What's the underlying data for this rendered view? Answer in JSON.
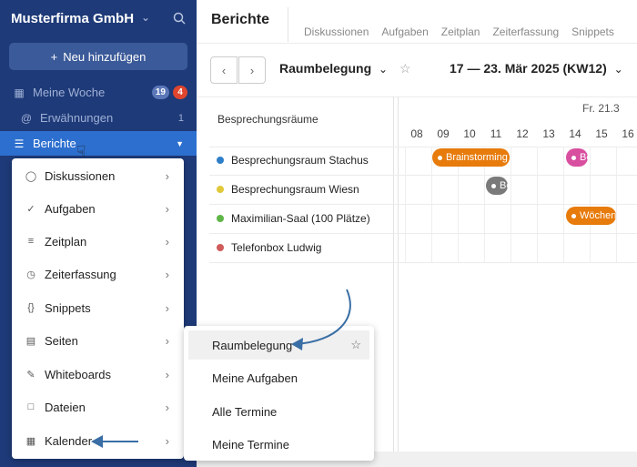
{
  "sidebar": {
    "org_name": "Musterfirma GmbH",
    "new_button": "Neu hinzufügen",
    "items": [
      {
        "label": "Meine Woche",
        "badge1": "19",
        "badge2": "4"
      },
      {
        "label": "Erwähnungen",
        "count": "1"
      },
      {
        "label": "Berichte"
      }
    ]
  },
  "berichte_menu": [
    {
      "label": "Diskussionen",
      "icon": "chat-icon"
    },
    {
      "label": "Aufgaben",
      "icon": "check-circle-icon"
    },
    {
      "label": "Zeitplan",
      "icon": "timeline-icon"
    },
    {
      "label": "Zeiterfassung",
      "icon": "clock-icon"
    },
    {
      "label": "Snippets",
      "icon": "braces-icon"
    },
    {
      "label": "Seiten",
      "icon": "page-icon"
    },
    {
      "label": "Whiteboards",
      "icon": "pen-icon"
    },
    {
      "label": "Dateien",
      "icon": "file-icon"
    },
    {
      "label": "Kalender",
      "icon": "calendar-icon"
    }
  ],
  "kalender_submenu": [
    {
      "label": "Raumbelegung"
    },
    {
      "label": "Meine Aufgaben"
    },
    {
      "label": "Alle Termine"
    },
    {
      "label": "Meine Termine"
    }
  ],
  "main": {
    "title": "Berichte",
    "tabs": [
      "Diskussionen",
      "Aufgaben",
      "Zeitplan",
      "Zeiterfassung",
      "Snippets"
    ],
    "view_name": "Raumbelegung",
    "date_range": "17 — 23. Mär 2025 (KW12)",
    "rooms_header": "Besprechungsräume",
    "day_label": "Fr. 21.3",
    "hours": [
      "08",
      "09",
      "10",
      "11",
      "12",
      "13",
      "14",
      "15",
      "16"
    ],
    "rooms": [
      {
        "name": "Besprechungsraum Stachus",
        "color": "#2f7fc8"
      },
      {
        "name": "Besprechungsraum Wiesn",
        "color": "#e0c93a"
      },
      {
        "name": "Maximilian-Saal (100 Plätze)",
        "color": "#5fb548"
      },
      {
        "name": "Telefonbox Ludwig",
        "color": "#cf5b5b"
      }
    ],
    "events": [
      {
        "label": "Brainstorming",
        "color": "#e77b0c"
      },
      {
        "label": "Be",
        "color": "#d94fa0"
      },
      {
        "label": "Bo",
        "color": "#7a7a7a"
      },
      {
        "label": "Wöchen",
        "color": "#e77b0c"
      }
    ]
  },
  "colors": {
    "sidebar": "#1e3a78",
    "accent": "#2d6fcf",
    "badge_blue": "#5b77b8",
    "badge_red": "#e0452e"
  }
}
